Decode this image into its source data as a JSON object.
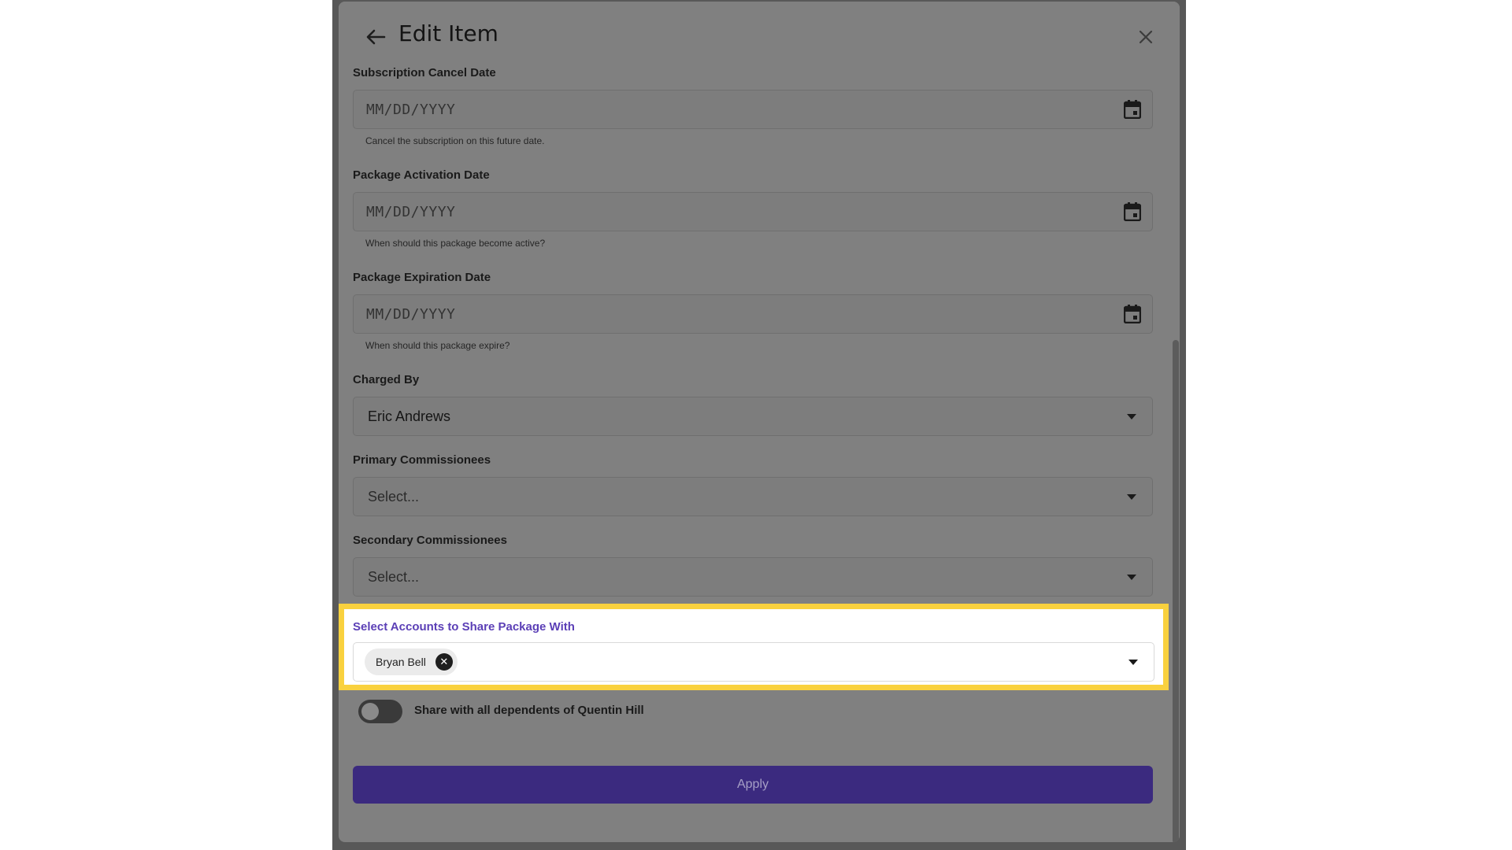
{
  "modal": {
    "title": "Edit Item"
  },
  "fields": {
    "cancel_date": {
      "label": "Subscription Cancel Date",
      "placeholder": "MM/DD/YYYY",
      "helper": "Cancel the subscription on this future date."
    },
    "activation_date": {
      "label": "Package Activation Date",
      "placeholder": "MM/DD/YYYY",
      "helper": "When should this package become active?"
    },
    "expiration_date": {
      "label": "Package Expiration Date",
      "placeholder": "MM/DD/YYYY",
      "helper": "When should this package expire?"
    },
    "charged_by": {
      "label": "Charged By",
      "value": "Eric Andrews"
    },
    "primary_commissionees": {
      "label": "Primary Commissionees",
      "placeholder": "Select..."
    },
    "secondary_commissionees": {
      "label": "Secondary Commissionees",
      "placeholder": "Select..."
    },
    "share_accounts": {
      "label": "Select Accounts to Share Package With",
      "chips": [
        "Bryan Bell"
      ]
    }
  },
  "toggle": {
    "label": "Share with all dependents of Quentin Hill",
    "on": false
  },
  "apply_label": "Apply",
  "colors": {
    "accent": "#5b3fb6",
    "highlight": "#f9d13e",
    "apply_bg": "#3b2a7f"
  }
}
